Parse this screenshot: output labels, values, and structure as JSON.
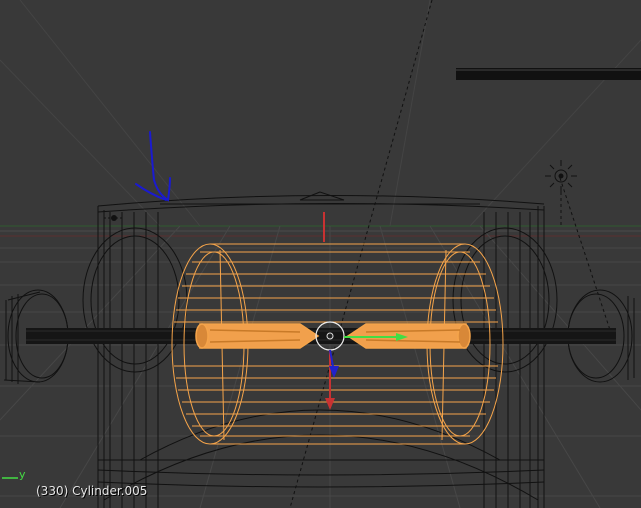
{
  "viewport": {
    "status_text": "(330) Cylinder.005",
    "axis_widget": {
      "y_label": "y"
    }
  },
  "colors": {
    "background": "#393939",
    "wire": "#111111",
    "selected_wire": "#f5a44a",
    "x_axis": "#c83232",
    "y_axis": "#44dd44",
    "z_axis": "#2222cc",
    "annotation": "#1a1ad0"
  },
  "icons": {
    "lamp": "sun-lamp-icon",
    "origin": "object-origin-icon",
    "manipulator": "transform-manipulator-icon"
  }
}
